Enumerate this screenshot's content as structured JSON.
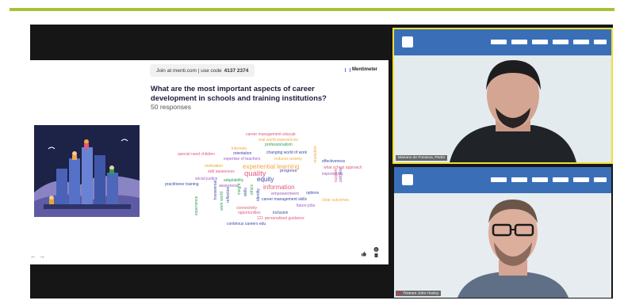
{
  "slide": {
    "join_prefix": "Join at menti.com | use code",
    "join_code": "4137 2374",
    "brand": "Mentimeter",
    "question": "What are the most important aspects of career development in schools and training institutions?",
    "responses": "50 responses",
    "nav_prev": "←",
    "nav_next": "→",
    "reaction_count": "0",
    "words": [
      {
        "text": "career management educab",
        "color": "#e05a7a"
      },
      {
        "text": "real world experiences",
        "color": "#f4a640"
      },
      {
        "text": "professionalism",
        "color": "#2f9d58"
      },
      {
        "text": "interests",
        "color": "#f4a640"
      },
      {
        "text": "orientation",
        "color": "#3b4aa8"
      },
      {
        "text": "changing world of work",
        "color": "#3b4aa8"
      },
      {
        "text": "special need children",
        "color": "#e05a7a"
      },
      {
        "text": "expertise of teachers",
        "color": "#9a5cc4"
      },
      {
        "text": "reduces anxiety",
        "color": "#f4a640"
      },
      {
        "text": "effectiveness",
        "color": "#3b4aa8"
      },
      {
        "text": "motivation",
        "color": "#e0ad2a"
      },
      {
        "text": "experiential learning",
        "color": "#f4a640"
      },
      {
        "text": "what school approach",
        "color": "#e05a7a"
      },
      {
        "text": "skill awareness",
        "color": "#e05a7a"
      },
      {
        "text": "quality",
        "color": "#e05a7a"
      },
      {
        "text": "progress",
        "color": "#3b4aa8"
      },
      {
        "text": "importability",
        "color": "#9a5cc4"
      },
      {
        "text": "social justice",
        "color": "#9a5cc4"
      },
      {
        "text": "adaptability",
        "color": "#2f9d58"
      },
      {
        "text": "equity",
        "color": "#3b4aa8"
      },
      {
        "text": "practitioner training",
        "color": "#3b4aa8"
      },
      {
        "text": "awareness",
        "color": "#9a5cc4"
      },
      {
        "text": "information",
        "color": "#e05a7a"
      },
      {
        "text": "empowerment",
        "color": "#9a5cc4"
      },
      {
        "text": "options",
        "color": "#3b4aa8"
      },
      {
        "text": "career management skills",
        "color": "#3b4aa8"
      },
      {
        "text": "clear outcomes",
        "color": "#f4a640"
      },
      {
        "text": "future jobs",
        "color": "#9a5cc4"
      },
      {
        "text": "connectivity",
        "color": "#e05a7a"
      },
      {
        "text": "opportunities",
        "color": "#e05a7a"
      },
      {
        "text": "inclusion",
        "color": "#3b4aa8"
      },
      {
        "text": "121 personalised guidance",
        "color": "#e05a7a"
      },
      {
        "text": "continous careers edu",
        "color": "#3b4aa8"
      },
      {
        "text": "resolution",
        "color": "#f4a640"
      },
      {
        "text": "support",
        "color": "#e05a7a"
      },
      {
        "text": "pathway",
        "color": "#9a5cc4"
      },
      {
        "text": "experience",
        "color": "#2f9d58"
      },
      {
        "text": "transversal",
        "color": "#3b4aa8"
      },
      {
        "text": "work world",
        "color": "#2f9d58"
      },
      {
        "text": "reflection",
        "color": "#3b4aa8"
      },
      {
        "text": "insight",
        "color": "#2f9d58"
      },
      {
        "text": "skills",
        "color": "#3b4aa8"
      },
      {
        "text": "ethics",
        "color": "#2f9d58"
      },
      {
        "text": "identity",
        "color": "#3b4aa8"
      }
    ]
  },
  "participants": [
    {
      "name": "Mariano de Fonseca, Pedro",
      "muted": false
    },
    {
      "name": "Tristram John Hooley",
      "muted": true
    }
  ],
  "colors": {
    "accent_bar": "#a6c23a",
    "active_speaker": "#f0df32",
    "banner": "#3a6fb7"
  },
  "icons": [
    "mentimeter-logo-icon",
    "arrow-left-icon",
    "arrow-right-icon",
    "thumbs-up-icon",
    "question-icon",
    "mic-muted-icon",
    "pin-icon"
  ]
}
